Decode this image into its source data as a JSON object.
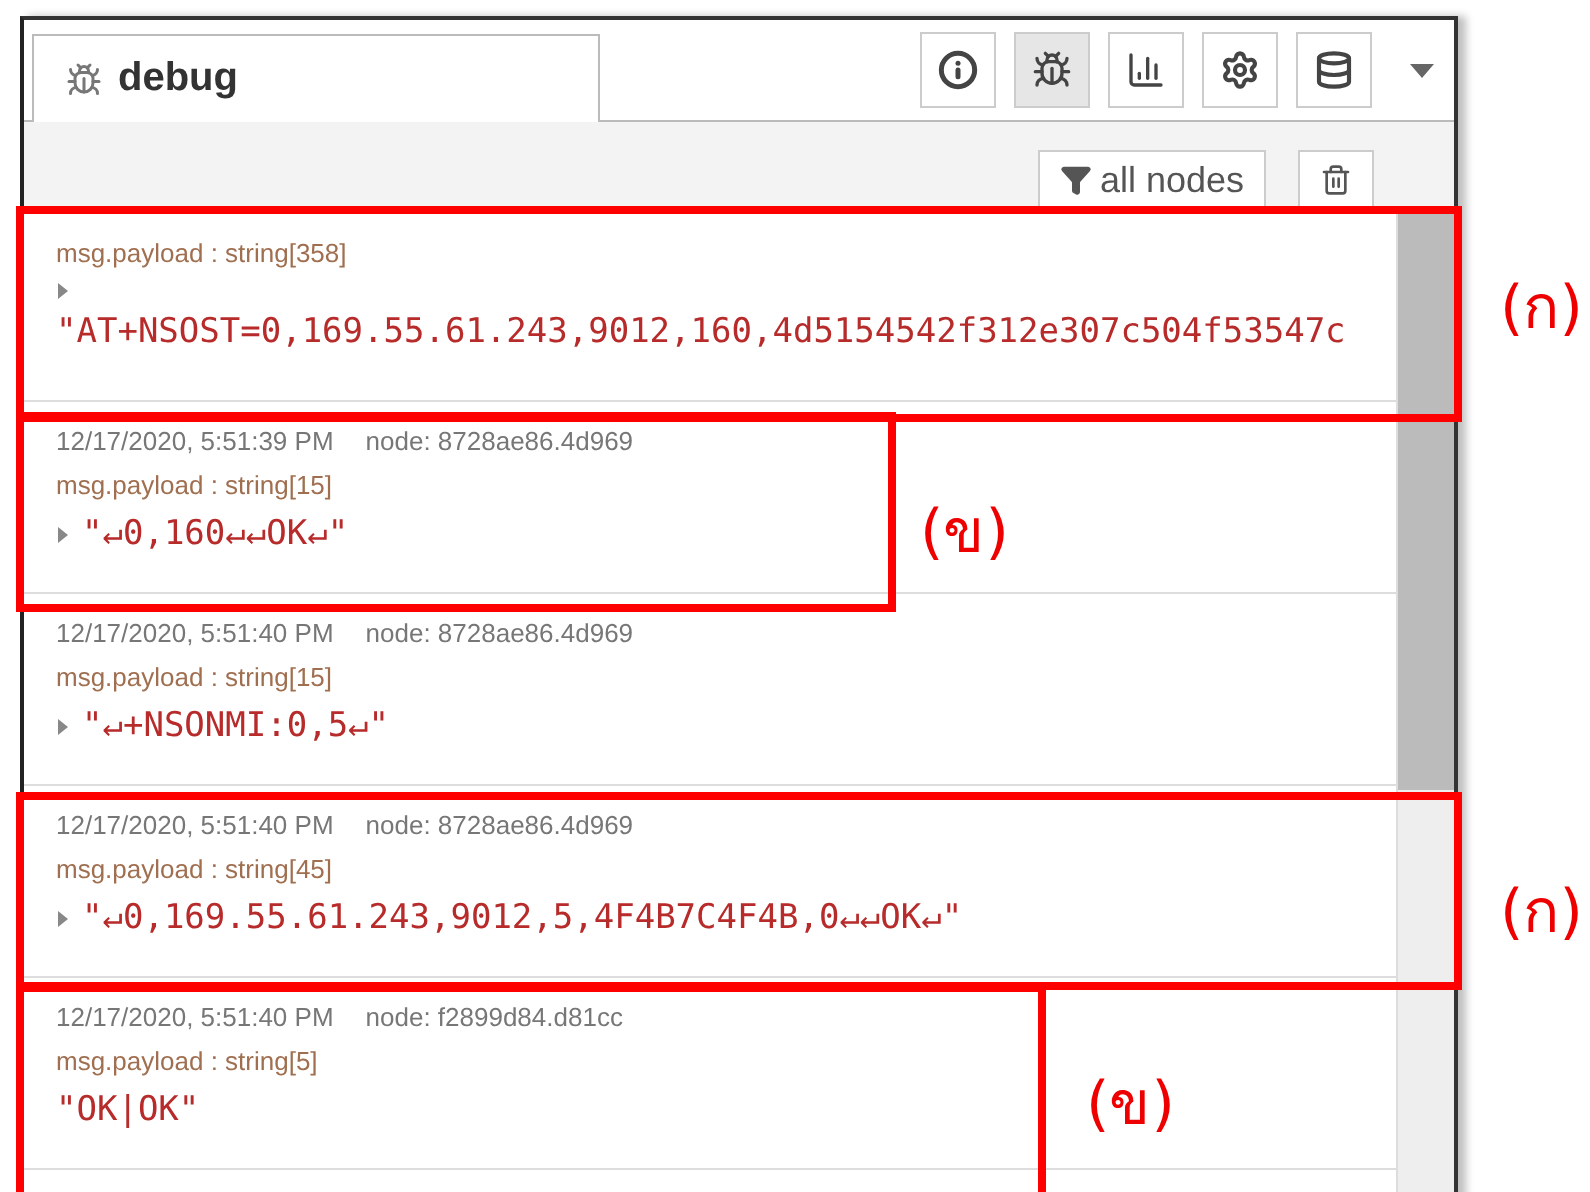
{
  "tab": {
    "label": "debug",
    "selected": true
  },
  "sidebar_buttons": [
    {
      "kind": "info",
      "selected": false
    },
    {
      "kind": "bug",
      "selected": true
    },
    {
      "kind": "chart",
      "selected": false
    },
    {
      "kind": "gear",
      "selected": false
    },
    {
      "kind": "database",
      "selected": false
    }
  ],
  "filter": {
    "label": "all nodes"
  },
  "messages": [
    {
      "topic": "msg.payload : string[358]",
      "value": "\"AT+NSOST=0,169.55.61.243,9012,160,4d5154542f312e307c504f53547c",
      "expandable": true
    },
    {
      "time": "12/17/2020, 5:51:39 PM",
      "node": "node: 8728ae86.4d969",
      "topic": "msg.payload : string[15]",
      "value": "\"↵0,160↵↵OK↵\"",
      "expandable": true
    },
    {
      "time": "12/17/2020, 5:51:40 PM",
      "node": "node: 8728ae86.4d969",
      "topic": "msg.payload : string[15]",
      "value": "\"↵+NSONMI:0,5↵\"",
      "expandable": true
    },
    {
      "time": "12/17/2020, 5:51:40 PM",
      "node": "node: 8728ae86.4d969",
      "topic": "msg.payload : string[45]",
      "value": "\"↵0,169.55.61.243,9012,5,4F4B7C4F4B,0↵↵OK↵\"",
      "expandable": true
    },
    {
      "time": "12/17/2020, 5:51:40 PM",
      "node": "node: f2899d84.d81cc",
      "topic": "msg.payload : string[5]",
      "value": "\"OK|OK\"",
      "expandable": false
    }
  ],
  "annotations": [
    {
      "label": "(ก)"
    },
    {
      "label": "(ข)"
    },
    {
      "label": "(ก)"
    },
    {
      "label": "(ข)"
    }
  ]
}
